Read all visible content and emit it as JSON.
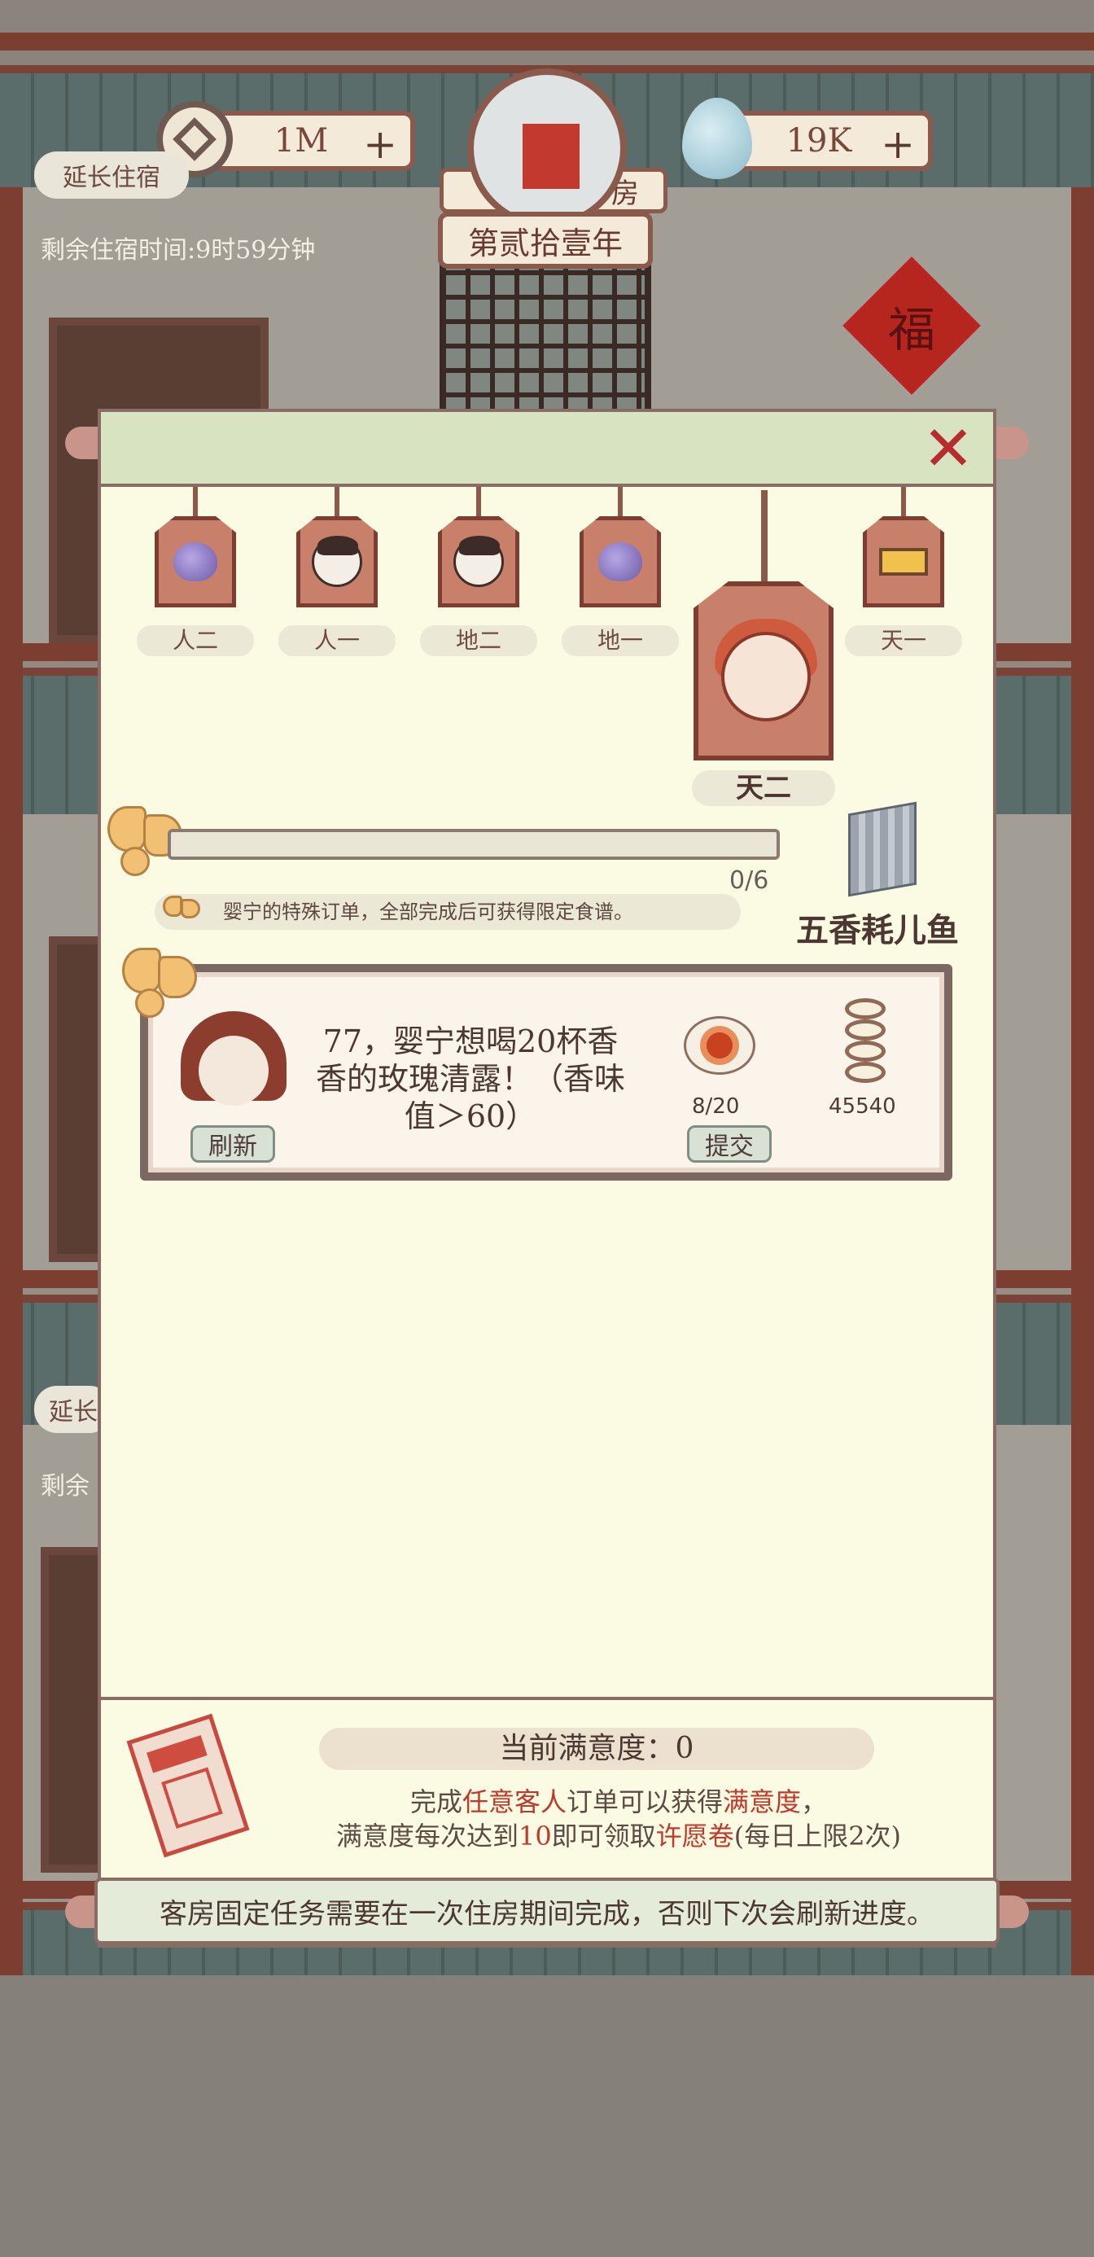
{
  "hud": {
    "copper": "1M",
    "spirit": "19K",
    "room_name": "房",
    "year": "第贰拾壹年",
    "extend_stay": "延长住宿",
    "extend_stay_short": "延长",
    "remaining_stay": "剩余住宿时间:9时59分钟",
    "remaining_short": "剩余",
    "decoration": "福"
  },
  "panel": {
    "close": "✕",
    "tabs": [
      {
        "label": "人二",
        "icon": "pouch-icon"
      },
      {
        "label": "人一",
        "icon": "guest-face-icon"
      },
      {
        "label": "地二",
        "icon": "guest-face-icon"
      },
      {
        "label": "地一",
        "icon": "pouch-icon"
      },
      {
        "label": "天一",
        "icon": "box-icon"
      }
    ],
    "selected_tab": {
      "label": "天二",
      "icon": "fox-girl-icon"
    },
    "progress": {
      "current": 0,
      "total": 6,
      "text": "0/6"
    },
    "special_note": "婴宁的特殊订单，全部完成后可获得限定食谱。",
    "reward_name": "五香耗儿鱼",
    "order": {
      "text": "77，婴宁想喝20杯香香的玫瑰清露！（香味值＞60）",
      "refresh": "刷新",
      "submit": "提交",
      "dish_count": "8/20",
      "reward_amount": "45540"
    },
    "satisfaction": "当前满意度：0",
    "desc": {
      "p1": "完成",
      "h1": "任意客人",
      "p2": "订单可以获得",
      "h2": "满意度",
      "p3": "，",
      "p4": "满意度每次达到",
      "h3": "10",
      "p5": "即可领取",
      "h4": "许愿卷",
      "p6": "(每日上限2次)"
    },
    "footer": "客房固定任务需要在一次住房期间完成，否则下次会刷新进度。"
  },
  "colors": {
    "accent_red": "#c0392b",
    "panel_bg": "#fbfbe3"
  }
}
